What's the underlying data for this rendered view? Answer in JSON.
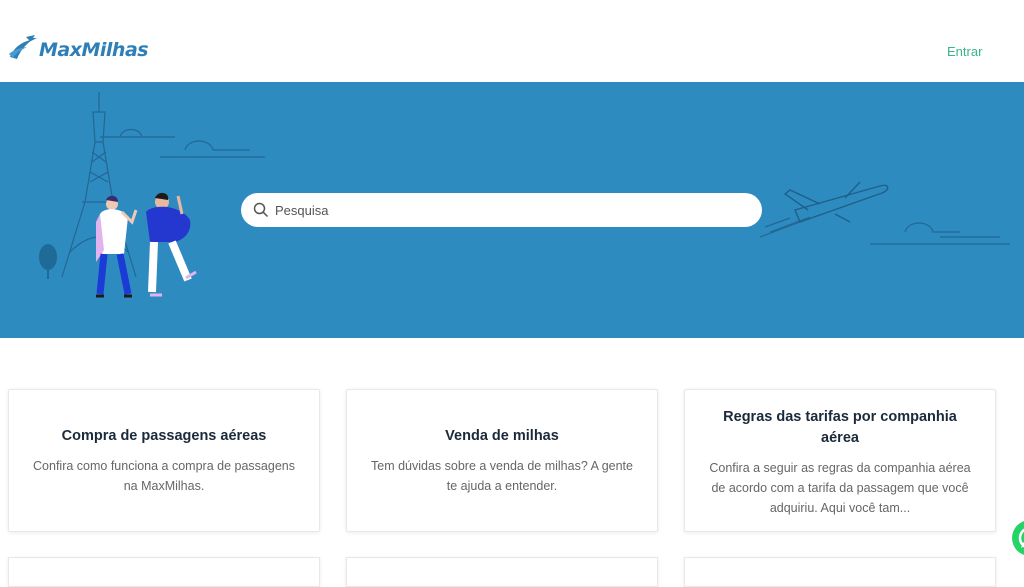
{
  "header": {
    "logo_text": "MaxMilhas",
    "login_label": "Entrar"
  },
  "search": {
    "placeholder": "Pesquisa"
  },
  "cards": [
    {
      "title": "Compra de passagens aéreas",
      "description": "Confira como funciona a compra de passagens na MaxMilhas."
    },
    {
      "title": "Venda de milhas",
      "description": "Tem dúvidas sobre a venda de milhas? A gente te ajuda a entender."
    },
    {
      "title": "Regras das tarifas por companhia aérea",
      "description": "Confira a seguir as regras da companhia aérea de acordo com a tarifa da passagem que você adquiriu. Aqui você tam..."
    }
  ],
  "colors": {
    "hero_background": "#2e8bc0",
    "brand_blue": "#2e7fb8",
    "login_green": "#3bb38f",
    "whatsapp_green": "#25d366"
  },
  "icons": {
    "logo": "plane-swoosh-icon",
    "search": "search-icon",
    "chat": "whatsapp-icon"
  }
}
